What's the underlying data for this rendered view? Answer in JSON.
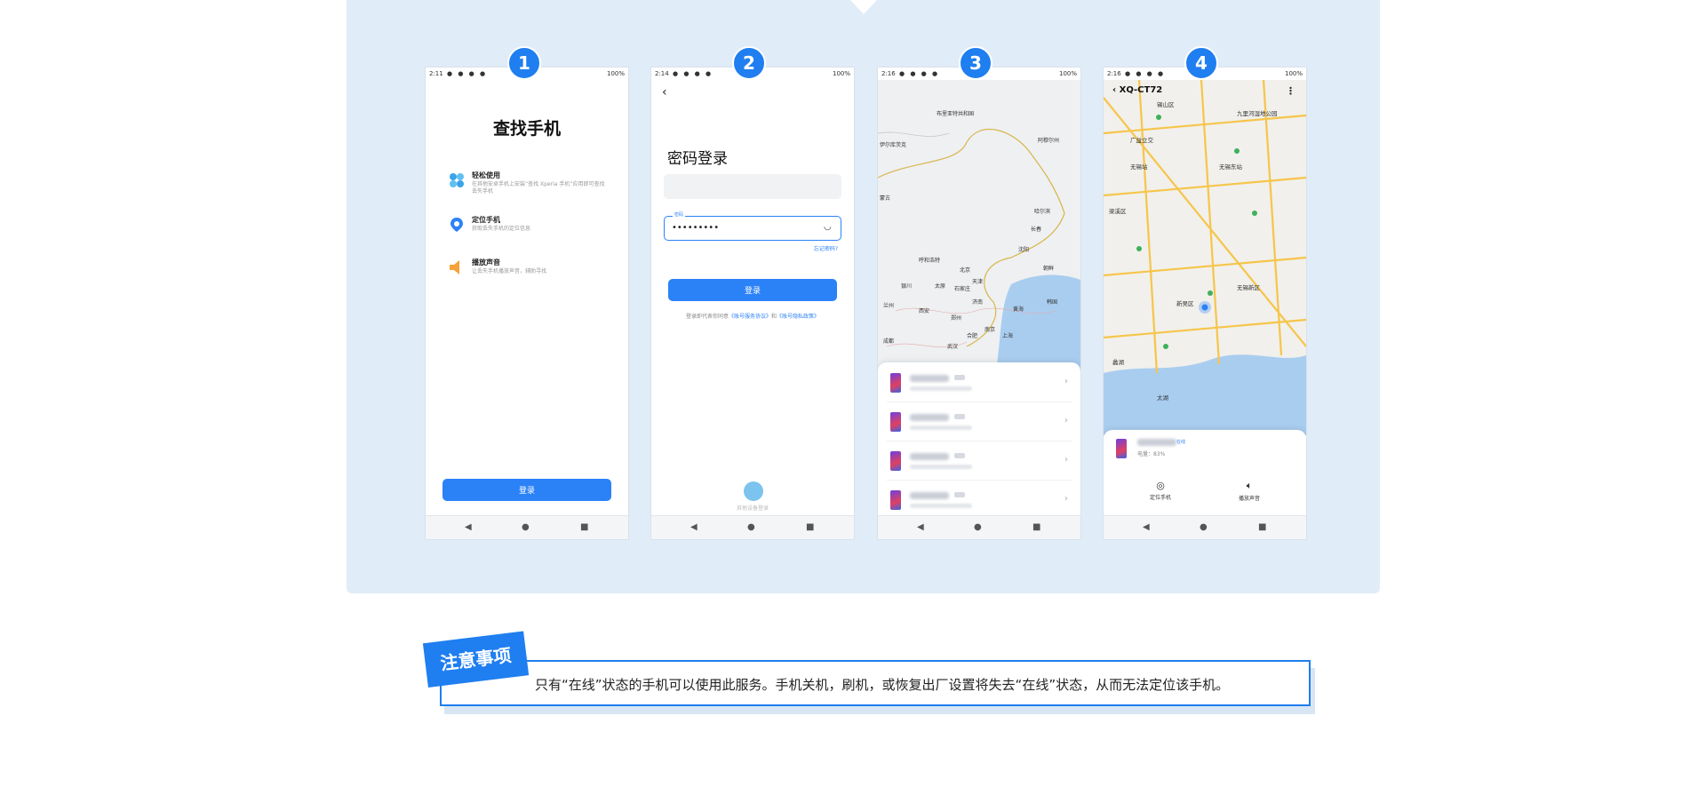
{
  "steps": [
    "1",
    "2",
    "3",
    "4"
  ],
  "phone1": {
    "time": "2:11",
    "battery": "100%",
    "title": "查找手机",
    "features": [
      {
        "name": "轻松使用",
        "desc": "在其他安卓手机上安装“查找 Xperia 手机”应用即可查找丢失手机",
        "icon": "petal-icon",
        "color": "#3aa4e8"
      },
      {
        "name": "定位手机",
        "desc": "获取丢失手机的定位信息",
        "icon": "location-pin-icon",
        "color": "#2b82f7"
      },
      {
        "name": "播放声音",
        "desc": "让丢失手机播放声音，辅助寻找",
        "icon": "speaker-icon",
        "color": "#f5a23a"
      }
    ],
    "login_label": "登录"
  },
  "phone2": {
    "time": "2:14",
    "battery": "100%",
    "title": "密码登录",
    "password_label": "密码",
    "password_value": "•••••••••",
    "forgot": "忘记密码?",
    "login_label": "登录",
    "terms_prefix": "登录即代表你同意",
    "terms_link1": "《账号服务协议》",
    "terms_and": "和",
    "terms_link2": "《账号隐私政策》",
    "device_login": "其他设备登录"
  },
  "phone3": {
    "time": "2:16",
    "battery": "100%",
    "map_labels": [
      "布里亚特共和国",
      "阿穆尔州",
      "伊尔库茨克",
      "蒙古",
      "哈尔滨",
      "长春",
      "呼和浩特",
      "北京",
      "沈阳",
      "朝鲜",
      "银川",
      "太原",
      "石家庄",
      "天津",
      "韩国",
      "兰州",
      "西安",
      "郑州",
      "济南",
      "黄海",
      "成都",
      "武汉",
      "合肥",
      "南京",
      "上海"
    ],
    "devices": 4
  },
  "phone4": {
    "time": "2:16",
    "battery": "100%",
    "device_name": "XQ-CT72",
    "map_labels": [
      "锡山区",
      "广益立交",
      "无锡东站",
      "新吴区",
      "梁溪区",
      "无锡新区",
      "太湖",
      "九里河湿地公园",
      "无锡站",
      "蠡湖"
    ],
    "online": "在线",
    "battery_line": "电量：83%",
    "actions": [
      "定位手机",
      "播放声音"
    ]
  },
  "notice": {
    "tag": "注意事项",
    "text": "只有“在线”状态的手机可以使用此服务。手机关机，刷机，或恢复出厂设置将失去“在线”状态，从而无法定位该手机。"
  },
  "colors": {
    "accent": "#1f7ef0",
    "panel": "#e0ecf7"
  }
}
